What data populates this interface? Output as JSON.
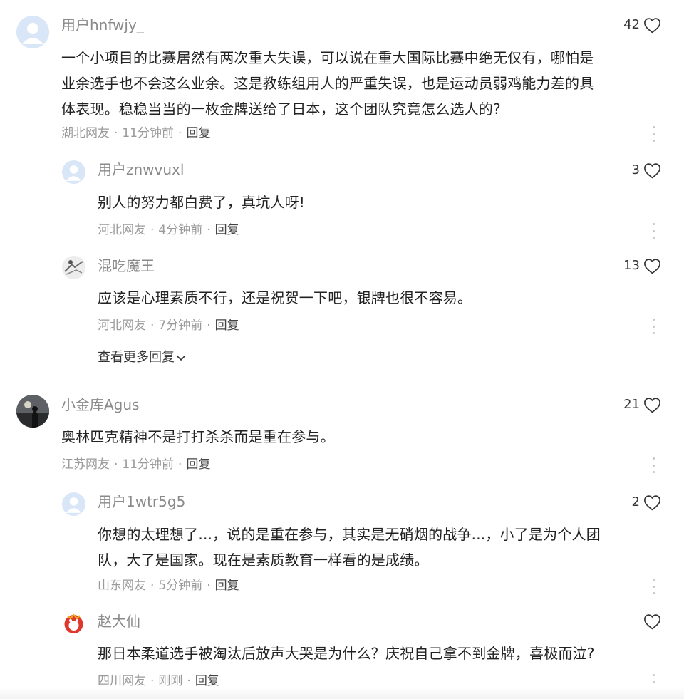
{
  "comments": [
    {
      "user": "用户hnfwjy_",
      "likes": "42",
      "lines": [
        "一个小项目的比赛居然有两次重大失误，可以说在重大国际比赛中绝无仅有，哪怕是",
        "业余选手也不会这么业余。这是教练组用人的严重失误，也是运动员弱鸡能力差的具",
        "体表现。稳稳当当的一枚金牌送给了日本，这个团队究竟怎么选人的?"
      ],
      "location": "湖北网友",
      "time": "11分钟前",
      "reply": "回复",
      "replies": [
        {
          "user": "用户znwvuxl",
          "likes": "3",
          "lines": [
            "别人的努力都白费了，真坑人呀!"
          ],
          "location": "河北网友",
          "time": "4分钟前",
          "reply": "回复"
        },
        {
          "user": "混吃魔王",
          "likes": "13",
          "lines": [
            "应该是心理素质不行，还是祝贺一下吧，银牌也很不容易。"
          ],
          "location": "河北网友",
          "time": "7分钟前",
          "reply": "回复"
        }
      ],
      "view_more": "查看更多回复"
    },
    {
      "user": "小金库Agus",
      "likes": "21",
      "lines": [
        "奥林匹克精神不是打打杀杀而是重在参与。"
      ],
      "location": "江苏网友",
      "time": "11分钟前",
      "reply": "回复",
      "replies": [
        {
          "user": "用户1wtr5g5",
          "likes": "2",
          "lines": [
            "你想的太理想了...，说的是重在参与，其实是无硝烟的战争...，小了是为个人团",
            "队，大了是国家。现在是素质教育一样看的是成绩。"
          ],
          "location": "山东网友",
          "time": "5分钟前",
          "reply": "回复"
        },
        {
          "user": "赵大仙",
          "likes": "",
          "lines": [
            "那日本柔道选手被淘汰后放声大哭是为什么？庆祝自己拿不到金牌，喜极而泣?"
          ],
          "location": "四川网友",
          "time": "刚刚",
          "reply": "回复"
        }
      ]
    }
  ],
  "meta_separator": "·",
  "icons": {
    "like": "heart-outline-icon",
    "more": "more-vertical-icon",
    "expand": "chevron-down-icon"
  },
  "colors": {
    "text": "#222222",
    "username": "#8a8a8a",
    "meta": "#9a9a9a",
    "avatar_default": "#d8e6f8"
  }
}
